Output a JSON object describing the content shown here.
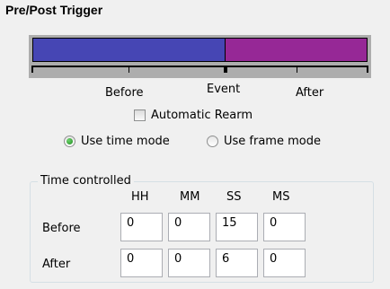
{
  "section_title": "Pre/Post Trigger",
  "trigger_bar": {
    "before_color": "#4646b4",
    "after_color": "#962896",
    "before_fraction": 0.57,
    "labels": {
      "before": "Before",
      "event": "Event",
      "after": "After"
    }
  },
  "automatic_rearm": {
    "label": "Automatic Rearm",
    "checked": false
  },
  "mode": {
    "time_label": "Use time mode",
    "frame_label": "Use frame mode",
    "selected": "time"
  },
  "time_controlled": {
    "legend": "Time controlled",
    "columns": [
      "HH",
      "MM",
      "SS",
      "MS"
    ],
    "rows": [
      {
        "label": "Before",
        "values": [
          "0",
          "0",
          "15",
          "0"
        ]
      },
      {
        "label": "After",
        "values": [
          "0",
          "0",
          "6",
          "0"
        ]
      }
    ]
  }
}
